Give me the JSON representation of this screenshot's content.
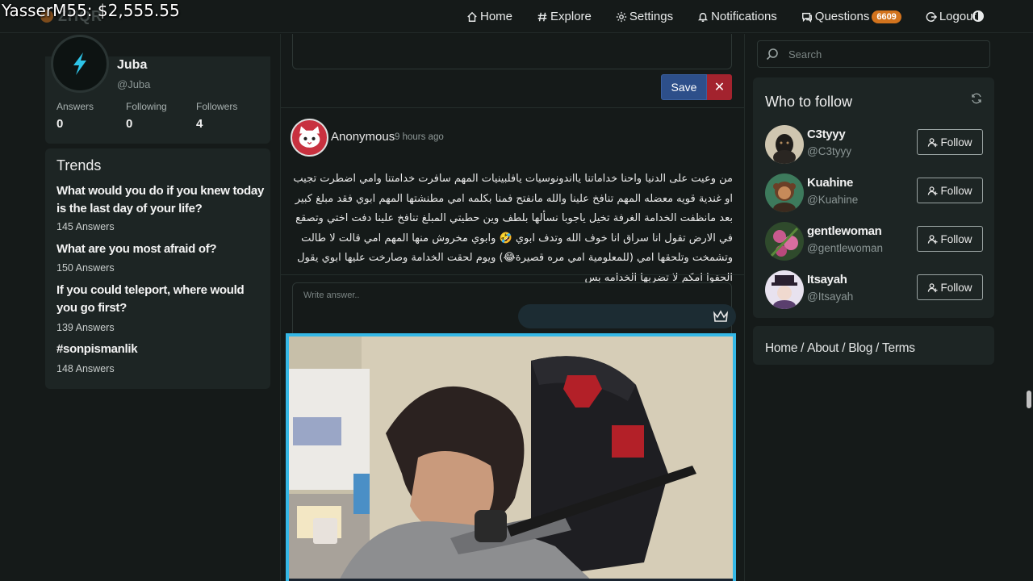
{
  "overlay": {
    "text": "YasserM55: $2,555.55"
  },
  "logo": {
    "text": "ZHQR"
  },
  "nav": {
    "home": "Home",
    "explore": "Explore",
    "settings": "Settings",
    "notifications": "Notifications",
    "questions": "Questions",
    "questions_badge": "6609",
    "logout": "Logout"
  },
  "profile": {
    "name": "Juba",
    "handle": "@Juba",
    "stats": [
      {
        "label": "Answers",
        "value": "0"
      },
      {
        "label": "Following",
        "value": "0"
      },
      {
        "label": "Followers",
        "value": "4"
      }
    ]
  },
  "trends": {
    "title": "Trends",
    "items": [
      {
        "question": "What would you do if you knew today is the last day of your life?",
        "answers": "145 Answers"
      },
      {
        "question": "What are you most afraid of?",
        "answers": "150 Answers"
      },
      {
        "question": "If you could teleport, where would you go first?",
        "answers": "139 Answers"
      },
      {
        "question": "#sonpismanlik",
        "answers": "148 Answers"
      }
    ]
  },
  "editor": {
    "save_label": "Save",
    "close_label": "✕"
  },
  "question": {
    "author": "Anonymous",
    "time": "9 hours ago",
    "body": "من وعيت على الدنيا واحنا خداماتنا يااندونوسيات يافلبينيات المهم سافرت خدامتنا وامي اضطرت تجيب او غندية قويه معضله المهم تنافخ علينا والله مانفتح فمنا بكلمه امي مطنشتها المهم ابوي فقد مبلغ كبير بعد مانظفت الخدامة الغرفة تخيل ياجوبا نسألها بلطف وين حطيتي المبلغ تنافخ علينا دفت اختي وتصقع في الارض تقول انا سراق انا خوف الله وتدف ابوي 🤣 وابوي مخروش منها المهم امي قالت لا طالت وتشمخت وتلحقها امي (للمعلومية امي مره قصيرة😂) ويوم لحقت الخدامة وصارخت عليها ابوي يقول الحقوا امكم لا تضربها الخدامه بس"
  },
  "answer": {
    "placeholder": "Write answer.."
  },
  "search": {
    "placeholder": "Search"
  },
  "who_to_follow": {
    "title": "Who to follow",
    "follow_label": "Follow",
    "users": [
      {
        "name": "C3tyyy",
        "handle": "@C3tyyy"
      },
      {
        "name": "Kuahine",
        "handle": "@Kuahine"
      },
      {
        "name": "gentlewoman",
        "handle": "@gentlewoman"
      },
      {
        "name": "Itsayah",
        "handle": "@Itsayah"
      }
    ]
  },
  "footer_links": [
    "Home",
    "About",
    "Blog",
    "Terms"
  ],
  "colors": {
    "background": "#151a19",
    "card": "#1d2524",
    "accent_orange": "#d2731d",
    "save_blue": "#2d4f8a",
    "close_red": "#a3232e",
    "cam_border": "#35b8e6"
  }
}
